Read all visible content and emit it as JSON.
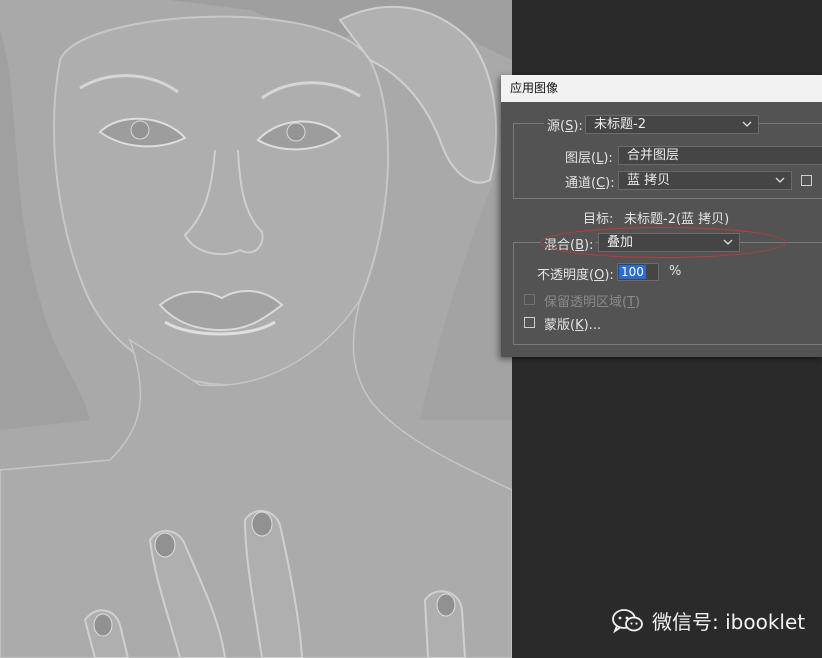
{
  "dialog": {
    "title": "应用图像",
    "source": {
      "label_pre": "源(",
      "key": "S",
      "label_post": "):",
      "value": "未标题-2"
    },
    "layer": {
      "label_pre": "图层(",
      "key": "L",
      "label_post": "):",
      "value": "合并图层"
    },
    "channel": {
      "label_pre": "通道(",
      "key": "C",
      "label_post": "):",
      "value": "蓝 拷贝"
    },
    "target": {
      "label": "目标:",
      "value": "未标题-2(蓝 拷贝)"
    },
    "blending": {
      "label_pre": "混合(",
      "key": "B",
      "label_post": "):",
      "value": "叠加"
    },
    "opacity": {
      "label_pre": "不透明度(",
      "key": "O",
      "label_post": "):",
      "value": "100",
      "unit": "%"
    },
    "preserve_transparency": {
      "label_pre": "保留透明区域(",
      "key": "T",
      "label_post": ")",
      "enabled": false
    },
    "mask": {
      "label_pre": "蒙版(",
      "key": "K",
      "label_post": ")...",
      "checked": false
    }
  },
  "watermark": {
    "text": "微信号: ibooklet"
  },
  "colors": {
    "dialog_bg": "#535353",
    "highlight_oval": "#c0393b",
    "selection": "#2a6cd6"
  }
}
